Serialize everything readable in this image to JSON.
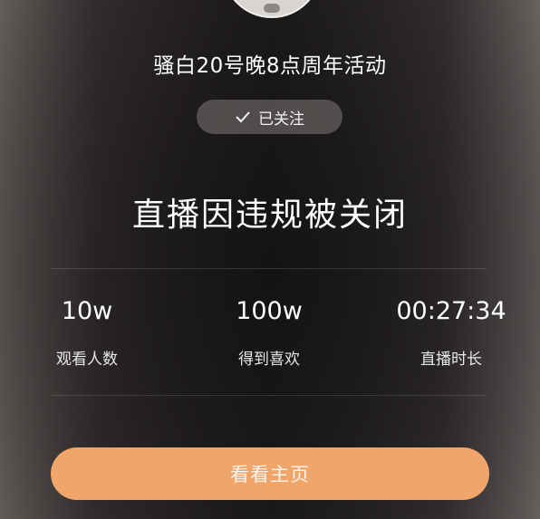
{
  "anchor": {
    "name": "骚白20号晚8点周年活动"
  },
  "follow": {
    "label": "已关注",
    "icon": "check-icon"
  },
  "status": {
    "headline": "直播因违规被关闭"
  },
  "stats": [
    {
      "value": "10w",
      "label": "观看人数"
    },
    {
      "value": "100w",
      "label": "得到喜欢"
    },
    {
      "value": "00:27:34",
      "label": "直播时长"
    }
  ],
  "actions": {
    "home_label": "看看主页"
  },
  "colors": {
    "button_bg": "#f0a56b",
    "pill_bg": "#7d7a79"
  }
}
